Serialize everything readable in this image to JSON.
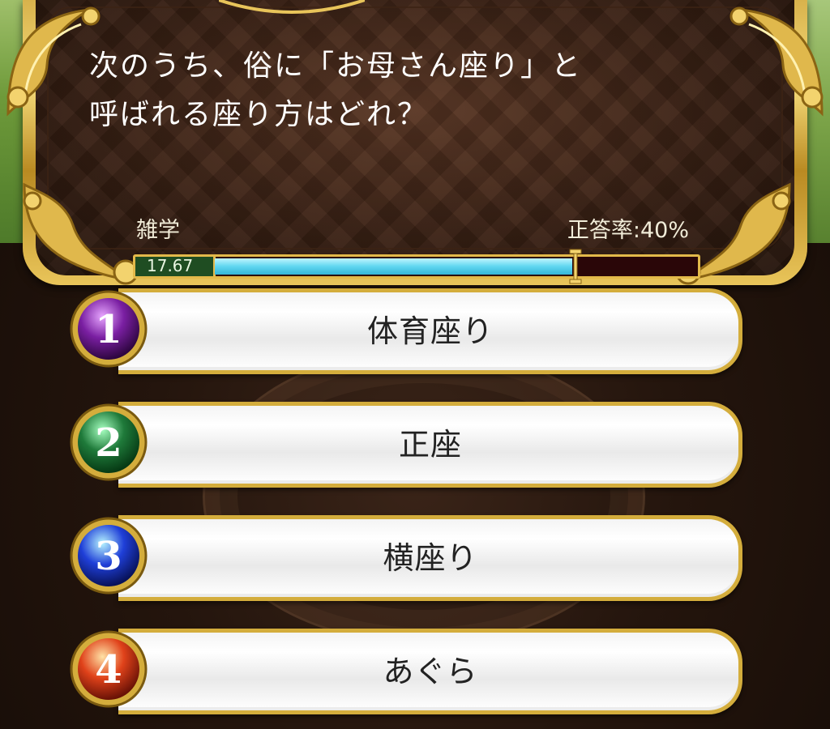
{
  "question": {
    "text": "次のうち、俗に「お母さん座り」と\n呼ばれる座り方はどれ？",
    "category": "雑学",
    "accuracy": "正答率:40%"
  },
  "timer": {
    "value": "17.67",
    "fill_fraction": 0.74
  },
  "answers": [
    {
      "number": "1",
      "label": "体育座り",
      "badge_color": "#7a1fa2"
    },
    {
      "number": "2",
      "label": "正座",
      "badge_color": "#1f7a3a"
    },
    {
      "number": "3",
      "label": "横座り",
      "badge_color": "#1f3fd8"
    },
    {
      "number": "4",
      "label": "あぐら",
      "badge_color": "#e0421a"
    }
  ],
  "colors": {
    "frame_gold": "#d4ad3c",
    "timer_fill": "#5fd6f0",
    "panel_brown": "#3b2215"
  },
  "icons": {
    "badge": "numbered-orb-icon",
    "ornament": "gold-scroll-ornament-icon",
    "timer_marker": "timer-marker-icon"
  }
}
